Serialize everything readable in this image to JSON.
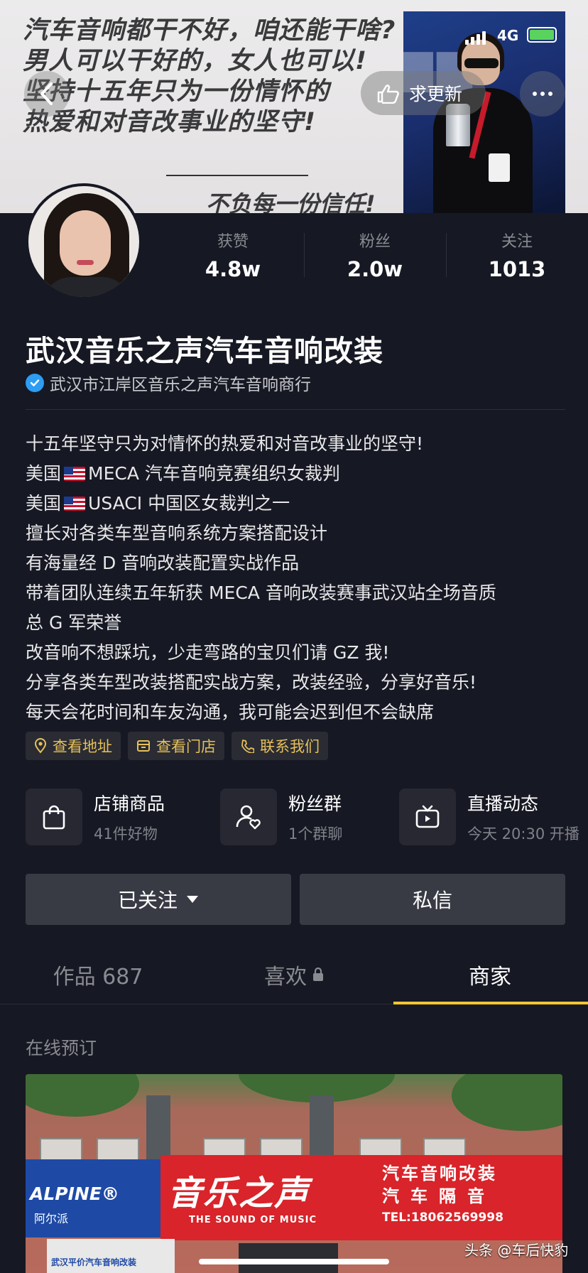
{
  "status_bar": {
    "time": "",
    "network": "4G"
  },
  "banner": {
    "lines": [
      "汽车音响都干不好，咱还能干啥?",
      "男人可以干好的，女人也可以!",
      "坚持十五年只为一份情怀的",
      "热爱和对音改事业的坚守!"
    ],
    "tail": "不负每一份信任!"
  },
  "nav": {
    "request_update_label": "求更新"
  },
  "stats": [
    {
      "label": "获赞",
      "value": "4.8w"
    },
    {
      "label": "粉丝",
      "value": "2.0w"
    },
    {
      "label": "关注",
      "value": "1013"
    }
  ],
  "profile": {
    "name": "武汉音乐之声汽车音响改装",
    "verified_text": "武汉市江岸区音乐之声汽车音响商行"
  },
  "bio": {
    "line1": "十五年坚守只为对情怀的热爱和对音改事业的坚守!",
    "line2_prefix": "美国",
    "line2_suffix": "MECA 汽车音响竞赛组织女裁判",
    "line3_prefix": "美国",
    "line3_suffix": "USACI 中国区女裁判之一",
    "line4": "擅长对各类车型音响系统方案搭配设计",
    "line5": "有海量经 D 音响改装配置实战作品",
    "line6": "带着团队连续五年斩获 MECA 音响改装赛事武汉站全场音质",
    "line7": "总 G 军荣誉",
    "line8": "改音响不想踩坑，少走弯路的宝贝们请 GZ 我!",
    "line9": "分享各类车型改装搭配实战方案，改装经验，分享好音乐!",
    "line10": "每天会花时间和车友沟通，我可能会迟到但不会缺席"
  },
  "chips": [
    "查看地址",
    "查看门店",
    "联系我们"
  ],
  "entries": [
    {
      "title": "店铺商品",
      "sub": "41件好物"
    },
    {
      "title": "粉丝群",
      "sub": "1个群聊"
    },
    {
      "title": "直播动态",
      "sub": "今天 20:30 开播"
    }
  ],
  "buttons": {
    "following": "已关注",
    "message": "私信"
  },
  "tabs": [
    {
      "label": "作品 687"
    },
    {
      "label": "喜欢"
    },
    {
      "label": "商家"
    }
  ],
  "section": {
    "title": "在线预订"
  },
  "shop_image": {
    "brand_left": "ALPINE®",
    "brand_left_cn": "阿尔派",
    "logo": "音乐之声",
    "logo_sub": "THE SOUND OF MUSIC",
    "right_line1": "汽车音响改装",
    "right_line2": "汽车隔音",
    "tel": "TEL:18062569998",
    "board_text": "武汉平价汽车音响改装"
  },
  "watermark": "头条 @车后快豹",
  "colors": {
    "accent": "#f8c52e",
    "chip_text": "#e6c05a",
    "verified": "#2d9cf3",
    "background": "#161823"
  }
}
